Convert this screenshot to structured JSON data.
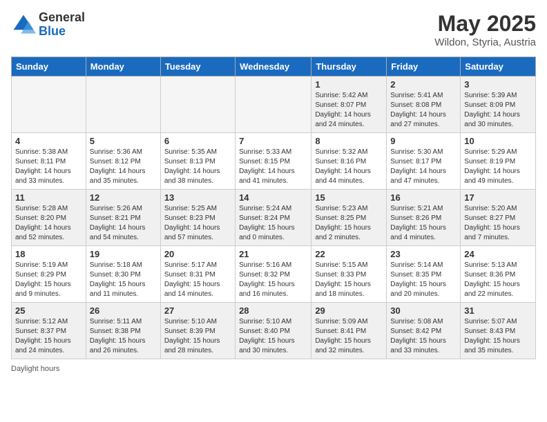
{
  "header": {
    "logo_general": "General",
    "logo_blue": "Blue",
    "month": "May 2025",
    "location": "Wildon, Styria, Austria"
  },
  "days_of_week": [
    "Sunday",
    "Monday",
    "Tuesday",
    "Wednesday",
    "Thursday",
    "Friday",
    "Saturday"
  ],
  "weeks": [
    [
      {
        "num": "",
        "info": "",
        "empty": true
      },
      {
        "num": "",
        "info": "",
        "empty": true
      },
      {
        "num": "",
        "info": "",
        "empty": true
      },
      {
        "num": "",
        "info": "",
        "empty": true
      },
      {
        "num": "1",
        "info": "Sunrise: 5:42 AM\nSunset: 8:07 PM\nDaylight: 14 hours\nand 24 minutes.",
        "empty": false
      },
      {
        "num": "2",
        "info": "Sunrise: 5:41 AM\nSunset: 8:08 PM\nDaylight: 14 hours\nand 27 minutes.",
        "empty": false
      },
      {
        "num": "3",
        "info": "Sunrise: 5:39 AM\nSunset: 8:09 PM\nDaylight: 14 hours\nand 30 minutes.",
        "empty": false
      }
    ],
    [
      {
        "num": "4",
        "info": "Sunrise: 5:38 AM\nSunset: 8:11 PM\nDaylight: 14 hours\nand 33 minutes.",
        "empty": false
      },
      {
        "num": "5",
        "info": "Sunrise: 5:36 AM\nSunset: 8:12 PM\nDaylight: 14 hours\nand 35 minutes.",
        "empty": false
      },
      {
        "num": "6",
        "info": "Sunrise: 5:35 AM\nSunset: 8:13 PM\nDaylight: 14 hours\nand 38 minutes.",
        "empty": false
      },
      {
        "num": "7",
        "info": "Sunrise: 5:33 AM\nSunset: 8:15 PM\nDaylight: 14 hours\nand 41 minutes.",
        "empty": false
      },
      {
        "num": "8",
        "info": "Sunrise: 5:32 AM\nSunset: 8:16 PM\nDaylight: 14 hours\nand 44 minutes.",
        "empty": false
      },
      {
        "num": "9",
        "info": "Sunrise: 5:30 AM\nSunset: 8:17 PM\nDaylight: 14 hours\nand 47 minutes.",
        "empty": false
      },
      {
        "num": "10",
        "info": "Sunrise: 5:29 AM\nSunset: 8:19 PM\nDaylight: 14 hours\nand 49 minutes.",
        "empty": false
      }
    ],
    [
      {
        "num": "11",
        "info": "Sunrise: 5:28 AM\nSunset: 8:20 PM\nDaylight: 14 hours\nand 52 minutes.",
        "empty": false
      },
      {
        "num": "12",
        "info": "Sunrise: 5:26 AM\nSunset: 8:21 PM\nDaylight: 14 hours\nand 54 minutes.",
        "empty": false
      },
      {
        "num": "13",
        "info": "Sunrise: 5:25 AM\nSunset: 8:23 PM\nDaylight: 14 hours\nand 57 minutes.",
        "empty": false
      },
      {
        "num": "14",
        "info": "Sunrise: 5:24 AM\nSunset: 8:24 PM\nDaylight: 15 hours\nand 0 minutes.",
        "empty": false
      },
      {
        "num": "15",
        "info": "Sunrise: 5:23 AM\nSunset: 8:25 PM\nDaylight: 15 hours\nand 2 minutes.",
        "empty": false
      },
      {
        "num": "16",
        "info": "Sunrise: 5:21 AM\nSunset: 8:26 PM\nDaylight: 15 hours\nand 4 minutes.",
        "empty": false
      },
      {
        "num": "17",
        "info": "Sunrise: 5:20 AM\nSunset: 8:27 PM\nDaylight: 15 hours\nand 7 minutes.",
        "empty": false
      }
    ],
    [
      {
        "num": "18",
        "info": "Sunrise: 5:19 AM\nSunset: 8:29 PM\nDaylight: 15 hours\nand 9 minutes.",
        "empty": false
      },
      {
        "num": "19",
        "info": "Sunrise: 5:18 AM\nSunset: 8:30 PM\nDaylight: 15 hours\nand 11 minutes.",
        "empty": false
      },
      {
        "num": "20",
        "info": "Sunrise: 5:17 AM\nSunset: 8:31 PM\nDaylight: 15 hours\nand 14 minutes.",
        "empty": false
      },
      {
        "num": "21",
        "info": "Sunrise: 5:16 AM\nSunset: 8:32 PM\nDaylight: 15 hours\nand 16 minutes.",
        "empty": false
      },
      {
        "num": "22",
        "info": "Sunrise: 5:15 AM\nSunset: 8:33 PM\nDaylight: 15 hours\nand 18 minutes.",
        "empty": false
      },
      {
        "num": "23",
        "info": "Sunrise: 5:14 AM\nSunset: 8:35 PM\nDaylight: 15 hours\nand 20 minutes.",
        "empty": false
      },
      {
        "num": "24",
        "info": "Sunrise: 5:13 AM\nSunset: 8:36 PM\nDaylight: 15 hours\nand 22 minutes.",
        "empty": false
      }
    ],
    [
      {
        "num": "25",
        "info": "Sunrise: 5:12 AM\nSunset: 8:37 PM\nDaylight: 15 hours\nand 24 minutes.",
        "empty": false
      },
      {
        "num": "26",
        "info": "Sunrise: 5:11 AM\nSunset: 8:38 PM\nDaylight: 15 hours\nand 26 minutes.",
        "empty": false
      },
      {
        "num": "27",
        "info": "Sunrise: 5:10 AM\nSunset: 8:39 PM\nDaylight: 15 hours\nand 28 minutes.",
        "empty": false
      },
      {
        "num": "28",
        "info": "Sunrise: 5:10 AM\nSunset: 8:40 PM\nDaylight: 15 hours\nand 30 minutes.",
        "empty": false
      },
      {
        "num": "29",
        "info": "Sunrise: 5:09 AM\nSunset: 8:41 PM\nDaylight: 15 hours\nand 32 minutes.",
        "empty": false
      },
      {
        "num": "30",
        "info": "Sunrise: 5:08 AM\nSunset: 8:42 PM\nDaylight: 15 hours\nand 33 minutes.",
        "empty": false
      },
      {
        "num": "31",
        "info": "Sunrise: 5:07 AM\nSunset: 8:43 PM\nDaylight: 15 hours\nand 35 minutes.",
        "empty": false
      }
    ]
  ],
  "footer": {
    "daylight_label": "Daylight hours"
  }
}
